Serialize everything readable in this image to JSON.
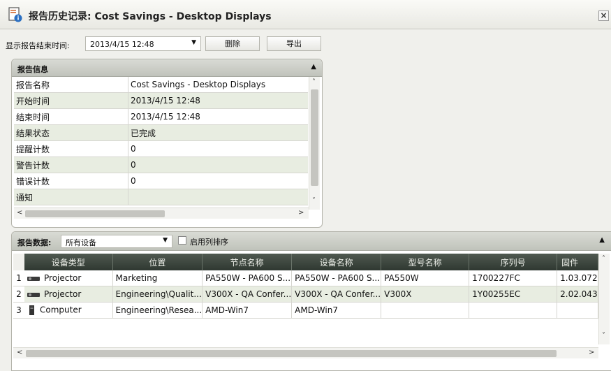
{
  "window": {
    "title": "报告历史记录: Cost Savings - Desktop Displays",
    "close_label": "×"
  },
  "toolbar": {
    "end_time_label": "显示报告结束时间:",
    "end_time_value": "2013/4/15 12:48",
    "delete_label": "删除",
    "export_label": "导出"
  },
  "report_info": {
    "title": "报告信息",
    "rows": [
      {
        "key": "报告名称",
        "value": "Cost Savings - Desktop Displays"
      },
      {
        "key": "开始时间",
        "value": "2013/4/15 12:48"
      },
      {
        "key": "结束时间",
        "value": "2013/4/15 12:48"
      },
      {
        "key": "结果状态",
        "value": "已完成"
      },
      {
        "key": "提醒计数",
        "value": "0"
      },
      {
        "key": "警告计数",
        "value": "0"
      },
      {
        "key": "错误计数",
        "value": "0"
      },
      {
        "key": "通知",
        "value": ""
      }
    ]
  },
  "report_data": {
    "label": "报告数据:",
    "filter_value": "所有设备",
    "enable_sort_label": "启用列排序",
    "columns": [
      "设备类型",
      "位置",
      "节点名称",
      "设备名称",
      "型号名称",
      "序列号",
      "固件"
    ],
    "rows": [
      {
        "idx": "1",
        "type_icon": "projector-icon",
        "type": "Projector",
        "location": "Marketing",
        "node": "PA550W - PA600 S...",
        "device": "PA550W - PA600 S...",
        "model": "PA550W",
        "serial": "1700227FC",
        "firmware": "1.03.072"
      },
      {
        "idx": "2",
        "type_icon": "projector-icon",
        "type": "Projector",
        "location": "Engineering\\Qualit...",
        "node": "V300X - QA Confer...",
        "device": "V300X - QA Confer...",
        "model": "V300X",
        "serial": "1Y00255EC",
        "firmware": "2.02.043"
      },
      {
        "idx": "3",
        "type_icon": "computer-icon",
        "type": "Computer",
        "location": "Engineering\\Resea...",
        "node": "AMD-Win7",
        "device": "AMD-Win7",
        "model": "",
        "serial": "",
        "firmware": ""
      }
    ]
  }
}
